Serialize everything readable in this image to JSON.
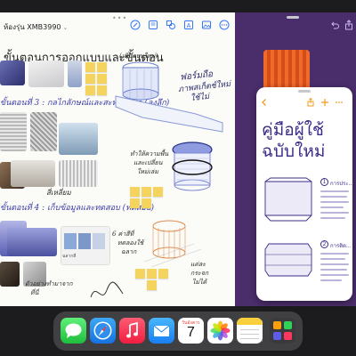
{
  "freeform": {
    "board_name": "ห้องรุ่น XMB3990",
    "board_title": "ขั้นตอนการออกแบบและขั้นตอน",
    "notes": {
      "cylinder_label": "(เพิ่มแบบใหม่)",
      "model_label_line1": "ฟอร์มถือ",
      "model_label_line2": "ภาพสเก็ตช์ใหม่",
      "model_label_line3": "ใช้ไม่",
      "material_label": "ค่าสีเขียว",
      "ring_label_line1": "ทำให้ความพื้น",
      "ring_label_line2": "และเปลี่ยน",
      "ring_label_line3": "ใหม่เล่ม",
      "step3": "ขั้นตอนที่ 3 : กลไกลักษณ์และสะท้อนวัสดุ (ลงลึก)",
      "step4": "ขั้นตอนที่ 4 : เก็บข้อมูลและทดสอบ (ทดสอบ)",
      "curve_label": "สี่เหลี่ยม",
      "color_label_line1": "6 ค่าสีที่",
      "color_label_line2": "ทดลองใช้",
      "color_label_line3": "ฉลาก",
      "file_label": "ฉลากสี",
      "bottom_label_line1": "ตัวอย่างทำมาจาก",
      "bottom_label_line2": "ที่นี่",
      "frame_label_line1": "แต่ละ",
      "frame_label_line2": "กระจก",
      "frame_label_line3": "ไม่ได้"
    }
  },
  "pages": {
    "heading_line1": "คู่มือผู้ใช้",
    "heading_line2": "ฉบับใหม่",
    "section1_num": "1",
    "section1_title": "การประ...",
    "section2_num": "2",
    "section2_title": "การติด..."
  },
  "dock": {
    "apps": [
      "Messages",
      "Safari",
      "Music",
      "Mail",
      "Calendar",
      "Photos",
      "Notes",
      "Shortcuts"
    ],
    "calendar_day_name": "วันอังคาร",
    "calendar_day_number": "7"
  },
  "colors": {
    "sticky": "#f4d35e",
    "pages_accent": "#3b2c8a",
    "purple_bg": "#4a2d6b",
    "toolbar_blue": "#3478f6",
    "pages_orange": "#f29b1d"
  }
}
